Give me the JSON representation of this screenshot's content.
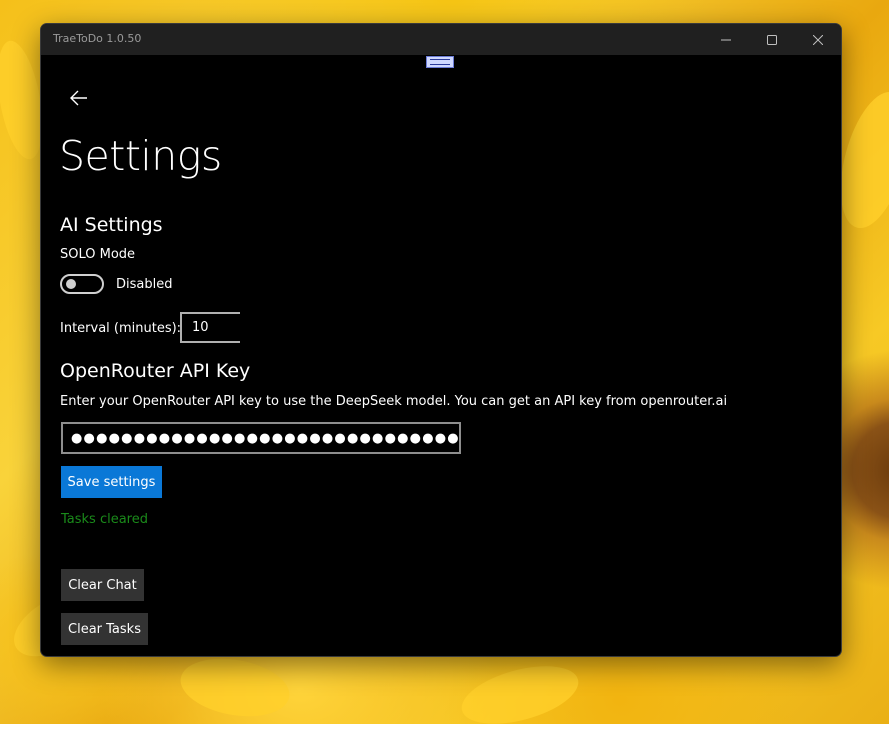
{
  "window": {
    "title": "TraeToDo 1.0.50",
    "controls": {
      "minimize_icon": "minimize-icon",
      "maximize_icon": "maximize-icon",
      "close_icon": "close-icon"
    }
  },
  "nav": {
    "back_icon": "back-arrow-icon"
  },
  "page": {
    "title": "Settings"
  },
  "ai_settings": {
    "heading": "AI Settings",
    "solo_mode_label": "SOLO Mode",
    "solo_mode_on": false,
    "solo_mode_state": "Disabled",
    "interval_label": "Interval (minutes):",
    "interval_value": "10"
  },
  "openrouter": {
    "heading": "OpenRouter API Key",
    "description": "Enter your OpenRouter API key to use the DeepSeek model. You can get an API key from openrouter.ai",
    "api_key_masked": "●●●●●●●●●●●●●●●●●●●●●●●●●●●●●●●●●●●●●●●●●●●●●"
  },
  "actions": {
    "save_label": "Save settings",
    "status_message": "Tasks cleared",
    "clear_chat_label": "Clear Chat",
    "clear_tasks_label": "Clear Tasks"
  },
  "colors": {
    "accent": "#0a78d7",
    "status_success": "#1a8a1a",
    "window_bg": "#000000",
    "titlebar_bg": "#202020",
    "secondary_button": "#333333"
  }
}
